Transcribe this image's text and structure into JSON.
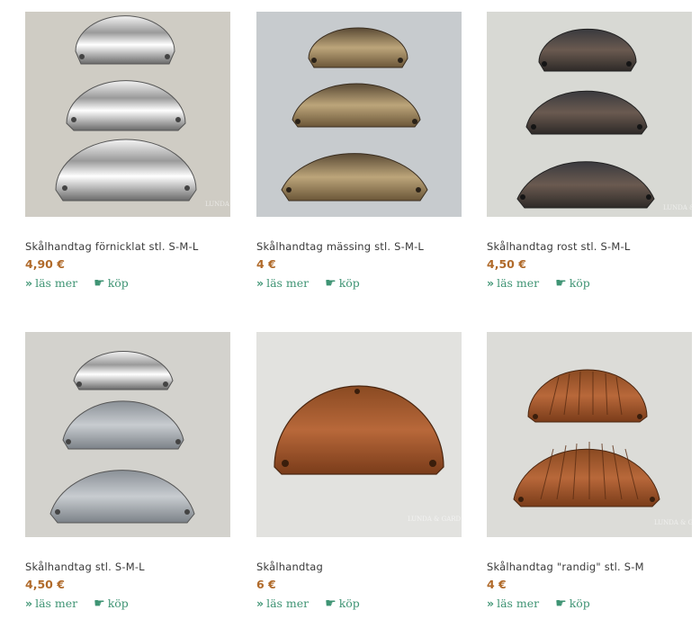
{
  "products": [
    {
      "title": "Skålhandtag förnicklat stl. S-M-L",
      "price": "4,90 €",
      "more": "läs mer",
      "buy": "köp"
    },
    {
      "title": "Skålhandtag mässing stl. S-M-L",
      "price": "4 €",
      "more": "läs mer",
      "buy": "köp"
    },
    {
      "title": "Skålhandtag rost stl. S-M-L",
      "price": "4,50 €",
      "more": "läs mer",
      "buy": "köp"
    },
    {
      "title": "Skålhandtag stl. S-M-L",
      "price": "4,50 €",
      "more": "läs mer",
      "buy": "köp"
    },
    {
      "title": "Skålhandtag",
      "price": "6 €",
      "more": "läs mer",
      "buy": "köp"
    },
    {
      "title": "Skålhandtag \"randig\" stl. S-M",
      "price": "4 €",
      "more": "läs mer",
      "buy": "köp"
    }
  ],
  "watermark": "LUNDA & GARD",
  "colors": {
    "price": "#b06a2a",
    "link": "#3f9474",
    "title": "#3a3a3a"
  },
  "icons": {
    "more": "double-chevron-icon",
    "buy": "pointing-hand-icon"
  }
}
